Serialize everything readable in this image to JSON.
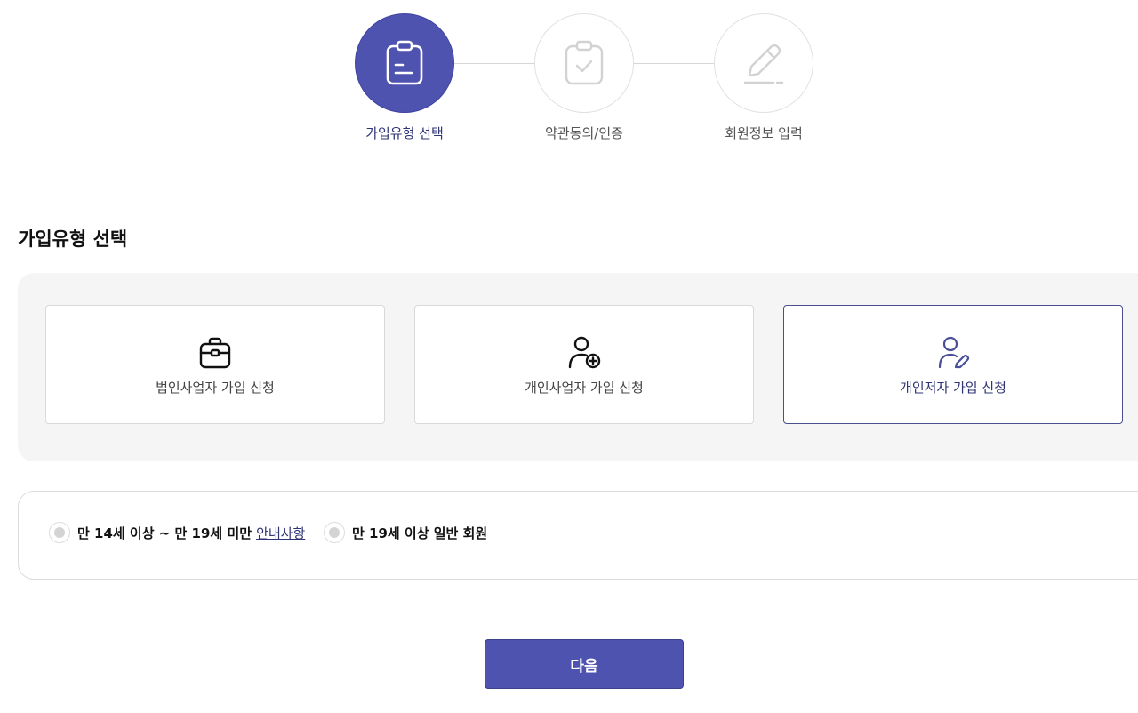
{
  "stepper": {
    "steps": [
      {
        "label": "가입유형 선택",
        "icon": "clipboard-icon",
        "state": "active"
      },
      {
        "label": "약관동의/인증",
        "icon": "clipboard-check-icon",
        "state": "pending"
      },
      {
        "label": "회원정보 입력",
        "icon": "pencil-icon",
        "state": "pending"
      }
    ]
  },
  "section": {
    "title": "가입유형 선택"
  },
  "signup_types": [
    {
      "label": "법인사업자 가입 신청",
      "icon": "briefcase-icon",
      "selected": false
    },
    {
      "label": "개인사업자 가입 신청",
      "icon": "user-add-icon",
      "selected": false
    },
    {
      "label": "개인저자 가입 신청",
      "icon": "user-edit-icon",
      "selected": true
    }
  ],
  "age_options": {
    "minor": {
      "label": "만 14세 이상 ~ 만 19세 미만",
      "link": "안내사항"
    },
    "adult": {
      "label": "만 19세 이상 일반 회원"
    }
  },
  "next_button": {
    "label": "다음"
  },
  "colors": {
    "accent": "#4f53b0",
    "accent_text": "#2f3475",
    "panel_bg": "#f5f5f5",
    "border": "#d9d9d9"
  }
}
